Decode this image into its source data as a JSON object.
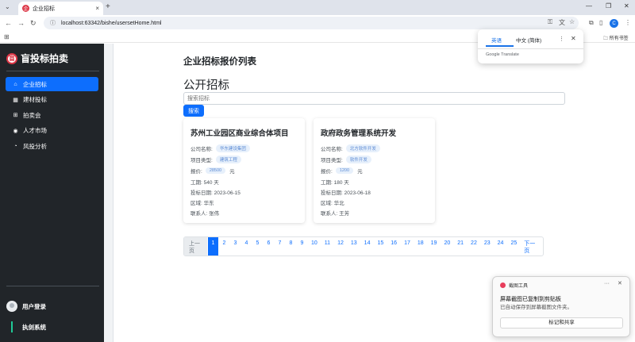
{
  "browser": {
    "tab_title": "企业招标",
    "tab_favicon_text": "企",
    "url": "localhost:63342/bishe/usersetHome.html",
    "bookmarks_all": "所有书签",
    "profile_initial": "C"
  },
  "translate_popup": {
    "lang_from": "英语",
    "lang_to": "中文 (简体)",
    "brand": "Google Translate"
  },
  "sidebar": {
    "brand_name": "盲投标拍卖",
    "brand_logo_text": "盲",
    "items": [
      {
        "label": "企业招标",
        "icon": "home-icon",
        "active": true
      },
      {
        "label": "建材投标",
        "icon": "table-icon",
        "active": false
      },
      {
        "label": "拍卖会",
        "icon": "grid-icon",
        "active": false
      },
      {
        "label": "人才市场",
        "icon": "person-circle-icon",
        "active": false
      },
      {
        "label": "风投分析",
        "icon": "speedometer-icon",
        "active": false
      }
    ],
    "user_label": "用户登录",
    "system_label": "执剑系统"
  },
  "main": {
    "page_title": "企业招标报价列表",
    "section_title": "公开招标",
    "search_placeholder": "搜索招标",
    "search_button": "搜索",
    "cards": [
      {
        "title": "苏州工业园区商业综合体项目",
        "company_label": "公司名称:",
        "company": "华东建设集团",
        "type_label": "项目类型:",
        "type": "建筑工程",
        "price_label": "报价:",
        "price": "28500",
        "price_unit": "元",
        "duration": "工期: 540 天",
        "date": "投标日期: 2023-06-15",
        "region": "区域: 华东",
        "contact": "联系人: 张伟"
      },
      {
        "title": "政府政务管理系统开发",
        "company_label": "公司名称:",
        "company": "北方软件开发",
        "type_label": "项目类型:",
        "type": "软件开发",
        "price_label": "报价:",
        "price": "1200",
        "price_unit": "元",
        "duration": "工期: 180 天",
        "date": "投标日期: 2023-06-18",
        "region": "区域: 华北",
        "contact": "联系人: 王芳"
      }
    ],
    "pagination": {
      "prev": "上一页",
      "next": "下一页",
      "pages": [
        "1",
        "2",
        "3",
        "4",
        "5",
        "6",
        "7",
        "8",
        "9",
        "10",
        "11",
        "12",
        "13",
        "14",
        "15",
        "16",
        "17",
        "18",
        "19",
        "20",
        "21",
        "22",
        "23",
        "24",
        "25"
      ],
      "active": "1"
    }
  },
  "snip_toast": {
    "app_name": "截图工具",
    "title": "屏幕截图已复制到剪贴板",
    "subtitle": "已自动保存到屏幕截图文件夹。",
    "button": "标记和共享"
  }
}
